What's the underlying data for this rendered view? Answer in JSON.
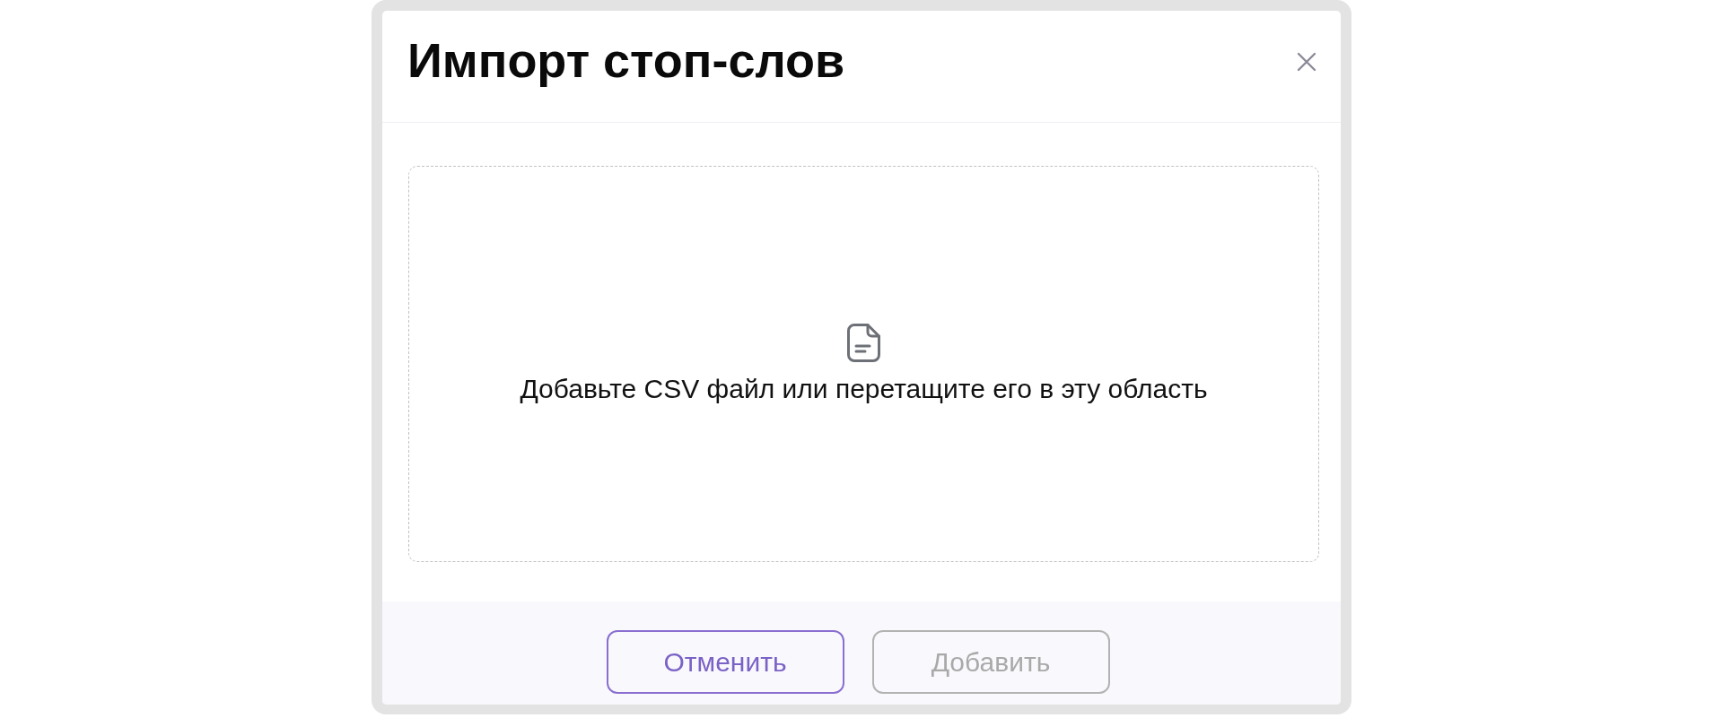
{
  "dialog": {
    "title": "Импорт стоп-слов"
  },
  "dropzone": {
    "hint": "Добавьте CSV файл или перетащите его в эту область"
  },
  "buttons": [
    {
      "label": "Отменить",
      "disabled": false
    },
    {
      "label": "Добавить",
      "disabled": true
    }
  ]
}
